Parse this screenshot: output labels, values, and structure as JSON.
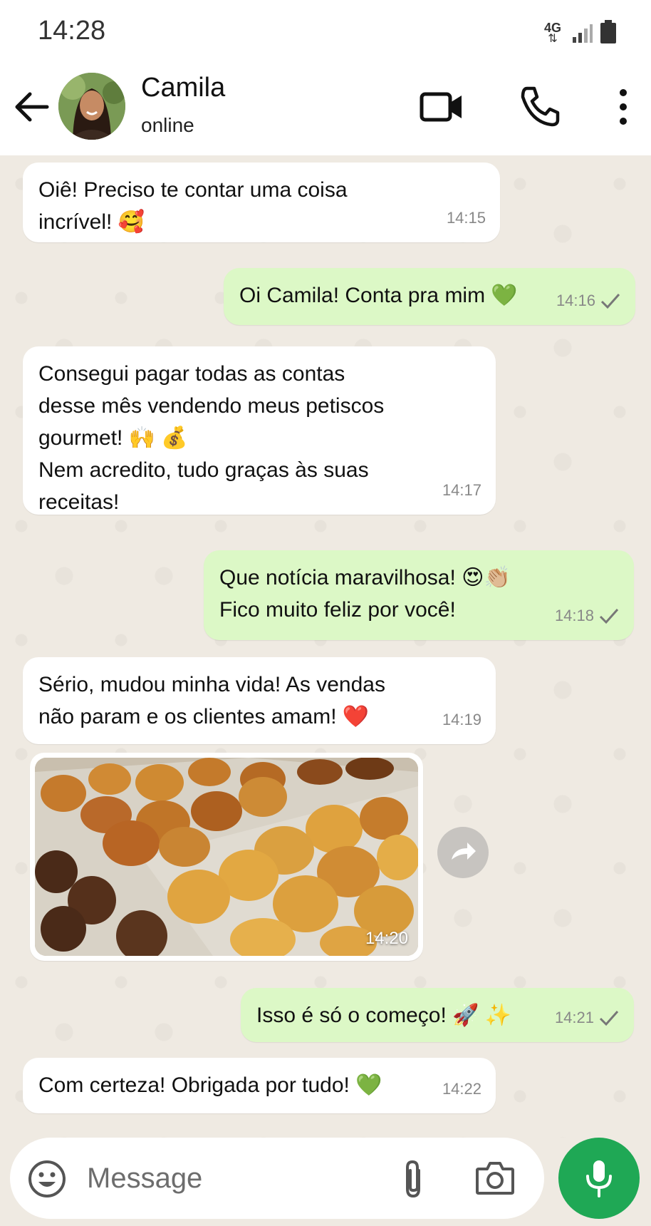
{
  "status_bar": {
    "time": "14:28",
    "network": "4G"
  },
  "header": {
    "contact_name": "Camila",
    "contact_status": "online",
    "icons": [
      "back-arrow-icon",
      "video-call-icon",
      "phone-call-icon",
      "more-options-icon"
    ]
  },
  "messages": [
    {
      "direction": "in",
      "text": "Oiê! Preciso te contar uma coisa\nincrível! 🥰",
      "time": "14:15"
    },
    {
      "direction": "out",
      "text": "Oi Camila! Conta pra mim 💚",
      "time": "14:16",
      "status": "sent"
    },
    {
      "direction": "in",
      "text": "Consegui pagar todas as contas\ndesse mês vendendo meus petiscos\ngourmet! 🙌 💰\nNem acredito, tudo graças às suas\nreceitas!",
      "time": "14:17"
    },
    {
      "direction": "out",
      "text": "Que notícia maravilhosa! 😍👏🏼\nFico muito feliz por você!",
      "time": "14:18",
      "status": "sent"
    },
    {
      "direction": "in",
      "text": "Sério, mudou minha vida! As vendas\nnão param e os clientes amam! ❤️",
      "time": "14:19"
    },
    {
      "direction": "in",
      "type": "image",
      "time": "14:20"
    },
    {
      "direction": "out",
      "text": "Isso é só o começo! 🚀 ✨",
      "time": "14:21",
      "status": "sent"
    },
    {
      "direction": "in",
      "text": "Com certeza! Obrigada por tudo! 💚",
      "time": "14:22"
    }
  ],
  "composer": {
    "placeholder": "Message"
  },
  "colors": {
    "incoming_bubble": "#ffffff",
    "outgoing_bubble": "#dcf8c6",
    "chat_background": "#efeae2",
    "accent": "#1fa855"
  }
}
